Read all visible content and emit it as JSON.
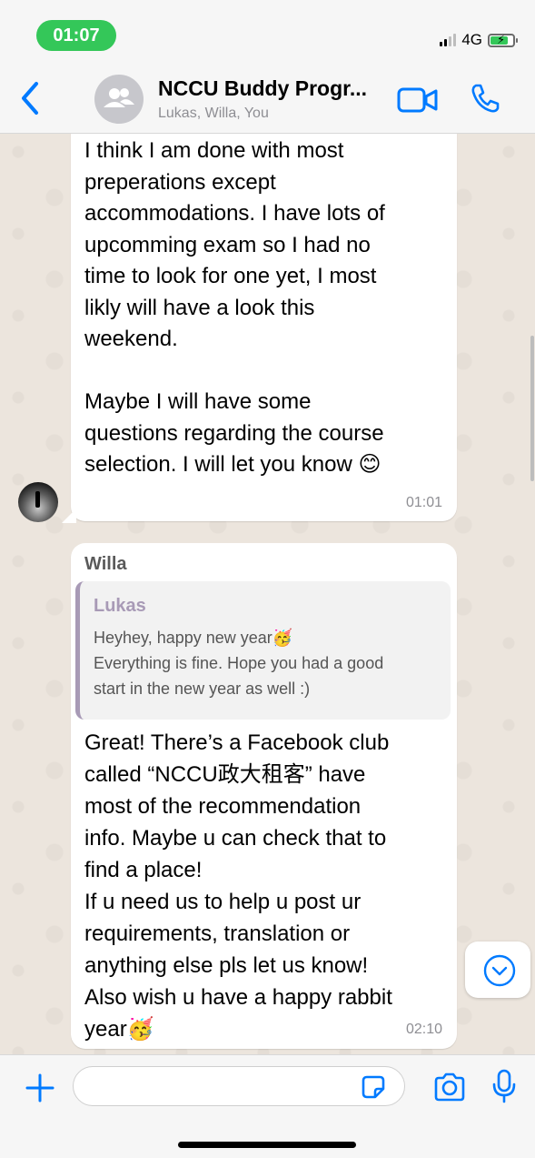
{
  "status_bar": {
    "time": "01:07",
    "network": "4G"
  },
  "header": {
    "title": "NCCU Buddy Progr...",
    "subtitle": "Lukas, Willa, You"
  },
  "messages": [
    {
      "text": "I think I am done with most\npreperations except\naccommodations. I have lots of\nupcomming exam so I had no\ntime to look for one yet, I most\nlikly will have a look this\nweekend.\n\nMaybe I will have some\nquestions regarding the course\nselection. I will let you know 😊",
      "time": "01:01"
    },
    {
      "sender": "Willa",
      "quote": {
        "name": "Lukas",
        "text": "Heyhey, happy new year🥳\nEverything is fine. Hope you had a good\nstart in the new year as well :)"
      },
      "text": "Great! There’s a Facebook club\ncalled “NCCU政大租客” have\nmost of the recommendation\ninfo. Maybe u can check that to\nfind a place!\nIf u need us to help u post ur\nrequirements, translation or\nanything else pls let us know!\nAlso wish u have a happy rabbit\nyear🥳",
      "time": "02:10"
    }
  ],
  "composer": {
    "value": "",
    "placeholder": ""
  },
  "icons": {
    "back": "chevron-left-icon",
    "group_avatar": "group-icon",
    "video": "video-camera-icon",
    "phone": "phone-icon",
    "scroll_down": "chevron-down-circle-icon",
    "attach": "plus-icon",
    "sticker": "sticker-icon",
    "camera": "camera-icon",
    "mic": "microphone-icon"
  },
  "colors": {
    "accent": "#007aff",
    "status_pill": "#34c759",
    "quote_bar": "#a89ab6"
  }
}
